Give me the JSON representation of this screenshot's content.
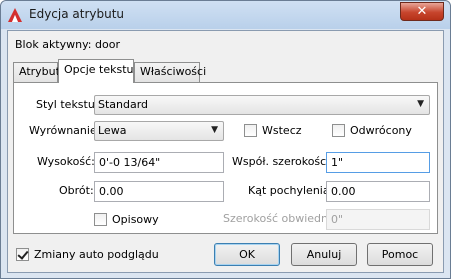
{
  "window": {
    "title": "Edycja atrybutu",
    "close_glyph": "✕"
  },
  "block_label": "Blok aktywny: door",
  "tabs": [
    {
      "label": "Atrybut",
      "active": false
    },
    {
      "label": "Opcje tekstu",
      "active": true
    },
    {
      "label": "Właściwości",
      "active": false
    }
  ],
  "text_options": {
    "style_label": "Styl tekstu:",
    "style_value": "Standard",
    "justify_label": "Wyrównanie:",
    "justify_value": "Lewa",
    "backwards_label": "Wstecz",
    "backwards_checked": false,
    "upside_label": "Odwrócony",
    "upside_checked": false,
    "height_label": "Wysokość:",
    "height_value": "0'-0 13/64\"",
    "width_factor_label": "Współ. szerokości:",
    "width_factor_value": "1\"",
    "rotation_label": "Obrót:",
    "rotation_value": "0.00",
    "oblique_label": "Kąt pochylenia:",
    "oblique_value": "0.00",
    "annotative_label": "Opisowy",
    "annotative_checked": false,
    "boundary_width_label": "Szerokość obwiedni:",
    "boundary_width_value": "0\""
  },
  "footer": {
    "auto_preview_label": "Zmiany auto podglądu",
    "auto_preview_checked": true,
    "ok_label": "OK",
    "cancel_label": "Anuluj",
    "help_label": "Pomoc"
  },
  "colors": {
    "accent": "#3c7fb1",
    "close": "#c7452d",
    "titlebar": "#b9d0ea"
  },
  "icons": {
    "app": "autocad-logo-icon",
    "close": "close-icon",
    "dropdown": "chevron-down-icon"
  }
}
